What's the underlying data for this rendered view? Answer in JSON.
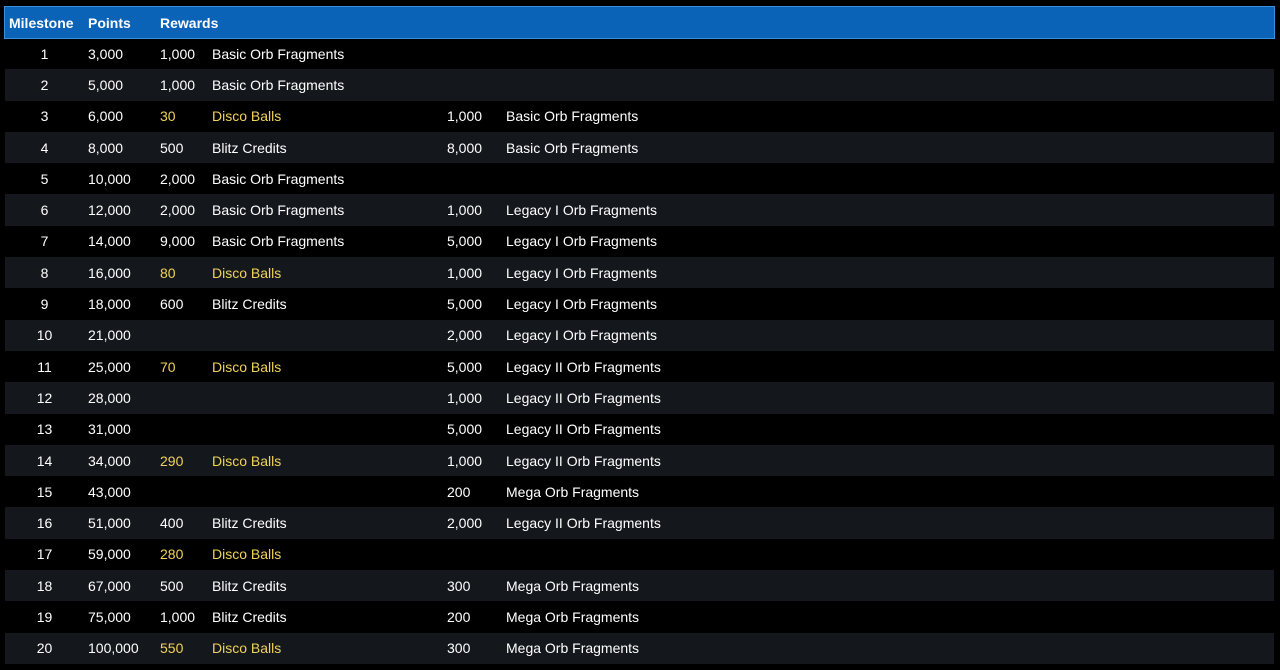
{
  "colors": {
    "header_bg": "#0b63b8",
    "row_alt_bg": "#14171c",
    "text": "#ffffff",
    "highlight": "#f0d35a"
  },
  "header": {
    "milestone": "Milestone",
    "points": "Points",
    "rewards": "Rewards"
  },
  "rows": [
    {
      "milestone": "1",
      "points": "3,000",
      "q1": "1,000",
      "r1": "Basic Orb Fragments",
      "h1": false,
      "q2": "",
      "r2": ""
    },
    {
      "milestone": "2",
      "points": "5,000",
      "q1": "1,000",
      "r1": "Basic Orb Fragments",
      "h1": false,
      "q2": "",
      "r2": ""
    },
    {
      "milestone": "3",
      "points": "6,000",
      "q1": "30",
      "r1": "Disco Balls",
      "h1": true,
      "q2": "1,000",
      "r2": "Basic Orb Fragments"
    },
    {
      "milestone": "4",
      "points": "8,000",
      "q1": "500",
      "r1": "Blitz Credits",
      "h1": false,
      "q2": "8,000",
      "r2": "Basic Orb Fragments"
    },
    {
      "milestone": "5",
      "points": "10,000",
      "q1": "2,000",
      "r1": "Basic Orb Fragments",
      "h1": false,
      "q2": "",
      "r2": ""
    },
    {
      "milestone": "6",
      "points": "12,000",
      "q1": "2,000",
      "r1": "Basic Orb Fragments",
      "h1": false,
      "q2": "1,000",
      "r2": "Legacy I Orb Fragments"
    },
    {
      "milestone": "7",
      "points": "14,000",
      "q1": "9,000",
      "r1": "Basic Orb Fragments",
      "h1": false,
      "q2": "5,000",
      "r2": "Legacy I Orb Fragments"
    },
    {
      "milestone": "8",
      "points": "16,000",
      "q1": "80",
      "r1": "Disco Balls",
      "h1": true,
      "q2": "1,000",
      "r2": "Legacy I Orb Fragments"
    },
    {
      "milestone": "9",
      "points": "18,000",
      "q1": "600",
      "r1": "Blitz Credits",
      "h1": false,
      "q2": "5,000",
      "r2": "Legacy I Orb Fragments"
    },
    {
      "milestone": "10",
      "points": "21,000",
      "q1": "",
      "r1": "",
      "h1": false,
      "q2": "2,000",
      "r2": "Legacy I Orb Fragments"
    },
    {
      "milestone": "11",
      "points": "25,000",
      "q1": "70",
      "r1": "Disco Balls",
      "h1": true,
      "q2": "5,000",
      "r2": "Legacy II Orb Fragments"
    },
    {
      "milestone": "12",
      "points": "28,000",
      "q1": "",
      "r1": "",
      "h1": false,
      "q2": "1,000",
      "r2": "Legacy II Orb Fragments"
    },
    {
      "milestone": "13",
      "points": "31,000",
      "q1": "",
      "r1": "",
      "h1": false,
      "q2": "5,000",
      "r2": "Legacy II Orb Fragments"
    },
    {
      "milestone": "14",
      "points": "34,000",
      "q1": "290",
      "r1": "Disco Balls",
      "h1": true,
      "q2": "1,000",
      "r2": "Legacy II Orb Fragments"
    },
    {
      "milestone": "15",
      "points": "43,000",
      "q1": "",
      "r1": "",
      "h1": false,
      "q2": "200",
      "r2": "Mega Orb Fragments"
    },
    {
      "milestone": "16",
      "points": "51,000",
      "q1": "400",
      "r1": "Blitz Credits",
      "h1": false,
      "q2": "2,000",
      "r2": "Legacy II Orb Fragments"
    },
    {
      "milestone": "17",
      "points": "59,000",
      "q1": "280",
      "r1": "Disco Balls",
      "h1": true,
      "q2": "",
      "r2": ""
    },
    {
      "milestone": "18",
      "points": "67,000",
      "q1": "500",
      "r1": "Blitz Credits",
      "h1": false,
      "q2": "300",
      "r2": "Mega Orb Fragments"
    },
    {
      "milestone": "19",
      "points": "75,000",
      "q1": "1,000",
      "r1": "Blitz Credits",
      "h1": false,
      "q2": "200",
      "r2": "Mega Orb Fragments"
    },
    {
      "milestone": "20",
      "points": "100,000",
      "q1": "550",
      "r1": "Disco Balls",
      "h1": true,
      "q2": "300",
      "r2": "Mega Orb Fragments"
    }
  ]
}
